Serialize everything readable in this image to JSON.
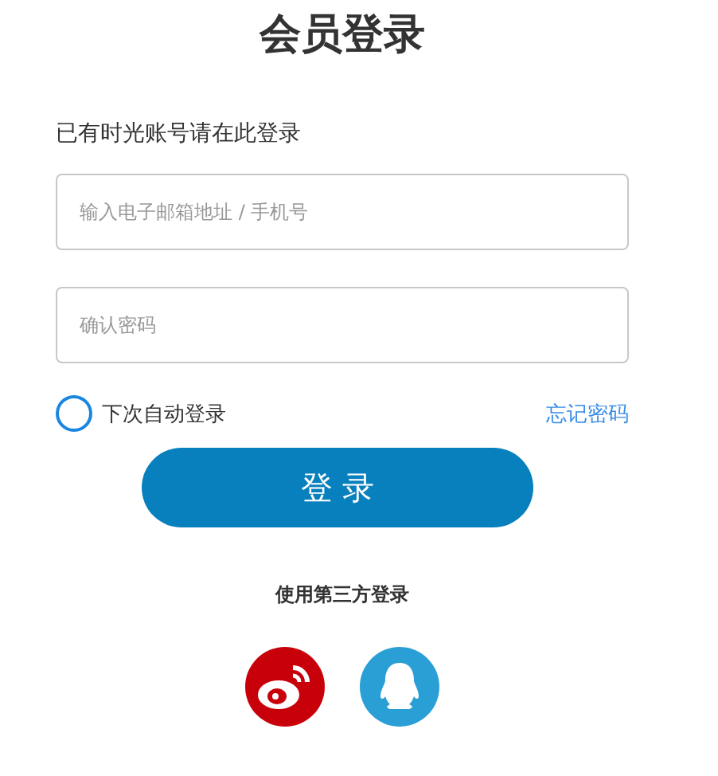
{
  "title": "会员登录",
  "subtitle": "已有时光账号请在此登录",
  "fields": [
    {
      "placeholder": "输入电子邮箱地址 / 手机号"
    },
    {
      "placeholder": "确认密码"
    }
  ],
  "remember": {
    "label": "下次自动登录",
    "checked": false
  },
  "forgot_link": "忘记密码",
  "login_button": "登 录",
  "third_party": {
    "label": "使用第三方登录",
    "providers": [
      {
        "kind": "weibo"
      },
      {
        "kind": "qq"
      }
    ]
  }
}
